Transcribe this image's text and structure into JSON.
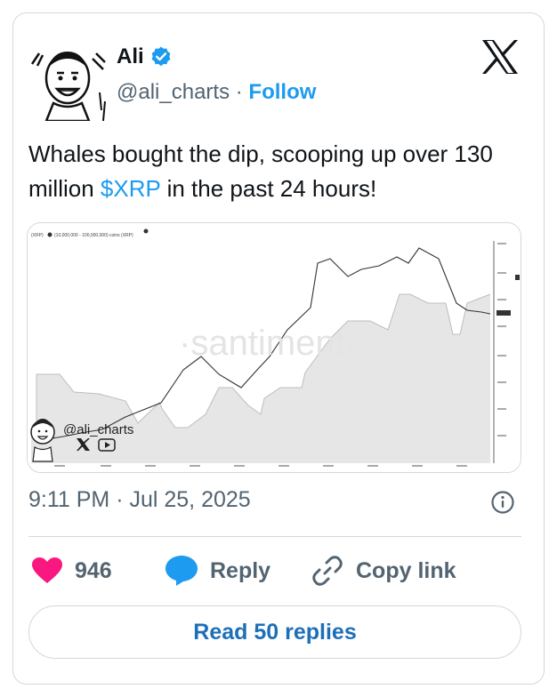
{
  "author": {
    "name": "Ali",
    "handle": "@ali_charts",
    "separator": " · ",
    "follow_label": "Follow"
  },
  "icons": {
    "verified": "verified-badge-icon",
    "brand": "x-logo-icon",
    "info": "info-icon",
    "like": "heart-icon",
    "reply": "reply-bubble-icon",
    "copy": "link-icon"
  },
  "colors": {
    "accent": "#1d9bf0",
    "like": "#f91880",
    "muted": "#536471",
    "border": "#cfd9de"
  },
  "tweet": {
    "text_before": "Whales bought the dip, scooping up over 130 million ",
    "cashtag": "$XRP",
    "text_after": " in the past 24 hours!",
    "timestamp": "9:11 PM · Jul 25, 2025"
  },
  "media": {
    "legend_a": "(XRP)",
    "legend_b": "(10,000,000 - 100,000,000) coins (XRP)",
    "watermark": "·santiment·",
    "overlay_handle": "@ali_charts"
  },
  "actions": {
    "likes_count": "946",
    "reply_label": "Reply",
    "copy_label": "Copy link",
    "read_replies_label": "Read 50 replies"
  }
}
